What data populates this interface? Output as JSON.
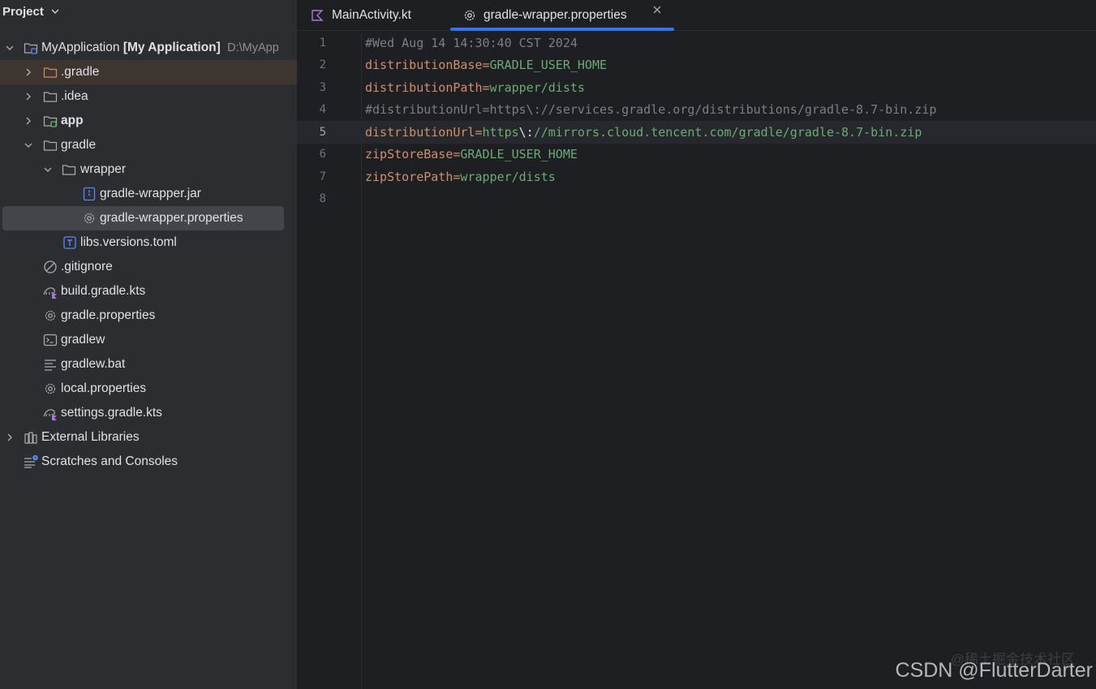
{
  "panel": {
    "title": "Project"
  },
  "tree": {
    "root": {
      "name": "MyApplication",
      "module": "[My Application]",
      "path": "D:\\MyApp"
    },
    "items": [
      {
        "label": ".gradle"
      },
      {
        "label": ".idea"
      },
      {
        "label": "app"
      },
      {
        "label": "gradle"
      },
      {
        "label": "wrapper"
      },
      {
        "label": "gradle-wrapper.jar"
      },
      {
        "label": "gradle-wrapper.properties"
      },
      {
        "label": "libs.versions.toml"
      },
      {
        "label": ".gitignore"
      },
      {
        "label": "build.gradle.kts"
      },
      {
        "label": "gradle.properties"
      },
      {
        "label": "gradlew"
      },
      {
        "label": "gradlew.bat"
      },
      {
        "label": "local.properties"
      },
      {
        "label": "settings.gradle.kts"
      },
      {
        "label": "External Libraries"
      },
      {
        "label": "Scratches and Consoles"
      }
    ]
  },
  "tabs": [
    {
      "label": "MainActivity.kt",
      "icon": "kotlin-file-icon"
    },
    {
      "label": "gradle-wrapper.properties",
      "icon": "gear-icon",
      "active": true
    }
  ],
  "editor": {
    "current_line": 5,
    "lines": [
      {
        "num": "1",
        "comment": "#Wed Aug 14 14:30:40 CST 2024"
      },
      {
        "num": "2",
        "key": "distributionBase",
        "eq": "=",
        "value": "GRADLE_USER_HOME"
      },
      {
        "num": "3",
        "key": "distributionPath",
        "eq": "=",
        "value": "wrapper/dists"
      },
      {
        "num": "4",
        "comment": "#distributionUrl=https\\://services.gradle.org/distributions/gradle-8.7-bin.zip"
      },
      {
        "num": "5",
        "key": "distributionUrl",
        "eq": "=",
        "value_a": "https",
        "esc": "\\:",
        "value_b": "//mirrors.cloud.tencent.com/gradle/gradle-8.7-bin.zip"
      },
      {
        "num": "6",
        "key": "zipStoreBase",
        "eq": "=",
        "value": "GRADLE_USER_HOME"
      },
      {
        "num": "7",
        "key": "zipStorePath",
        "eq": "=",
        "value": "wrapper/dists"
      },
      {
        "num": "8"
      }
    ]
  },
  "watermark": {
    "primary": "CSDN @FlutterDarter",
    "secondary": "@稀土掘金技术社区"
  },
  "colors": {
    "accent": "#3574f0",
    "key": "#cf8e6d",
    "value": "#6aab73",
    "comment": "#7a7e85"
  }
}
